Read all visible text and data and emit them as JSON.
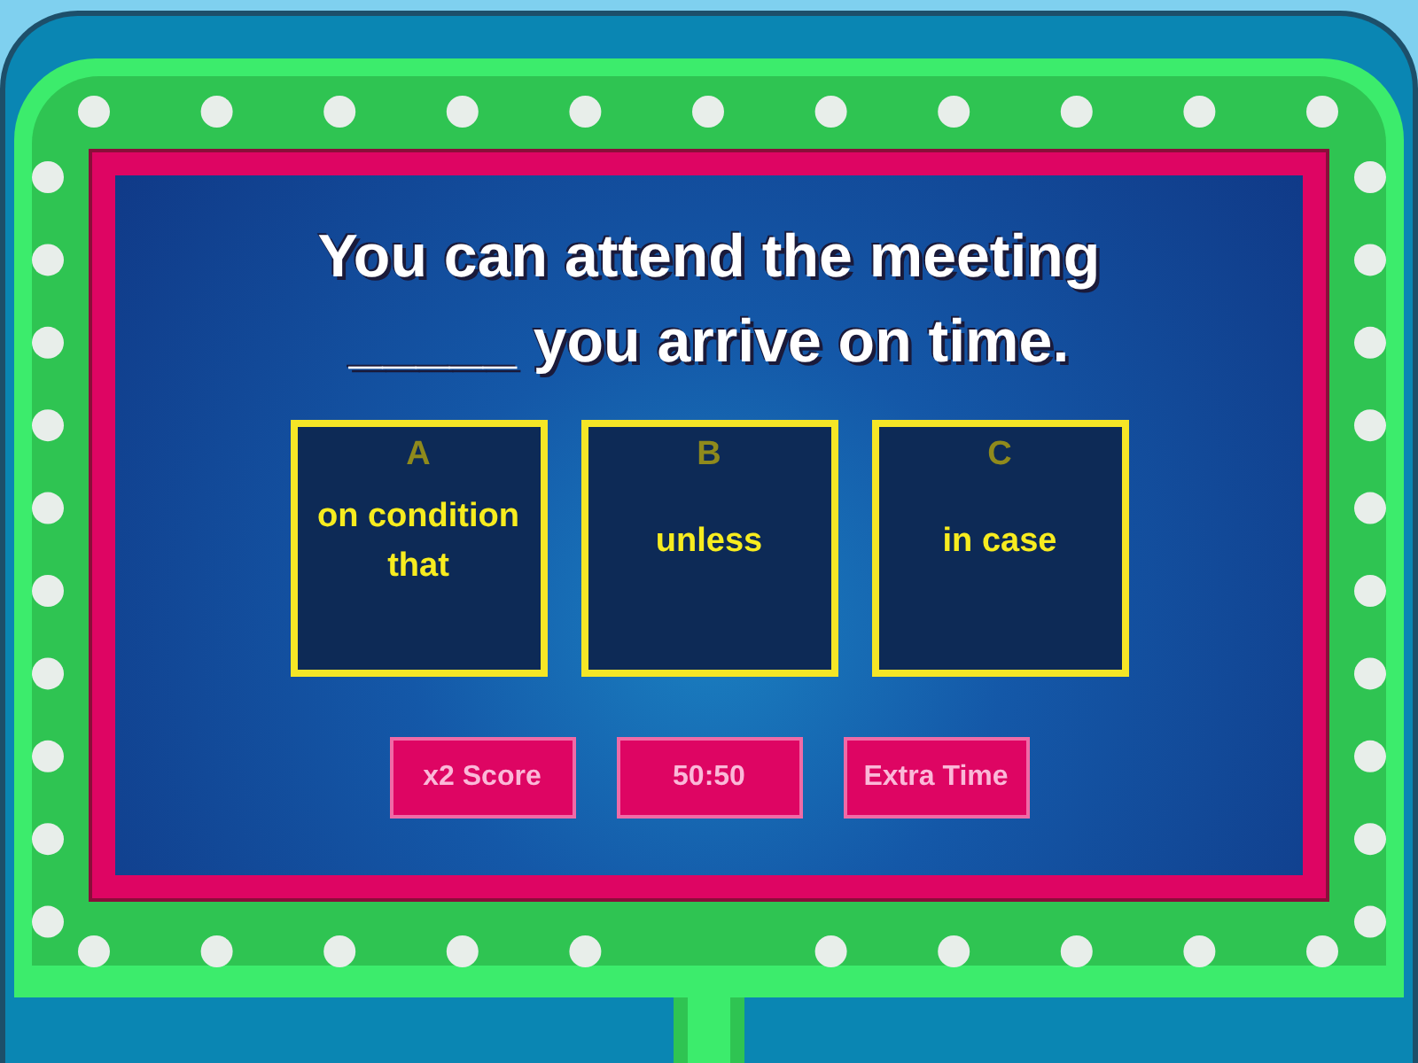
{
  "question": {
    "lines": [
      "You can attend the meeting",
      "_____ you arrive on time."
    ]
  },
  "options": [
    {
      "letter": "A",
      "text": "on condition that"
    },
    {
      "letter": "B",
      "text": "unless"
    },
    {
      "letter": "C",
      "text": "in case"
    }
  ],
  "lifelines": [
    {
      "label": "x2 Score"
    },
    {
      "label": "50:50"
    },
    {
      "label": "Extra Time"
    }
  ]
}
